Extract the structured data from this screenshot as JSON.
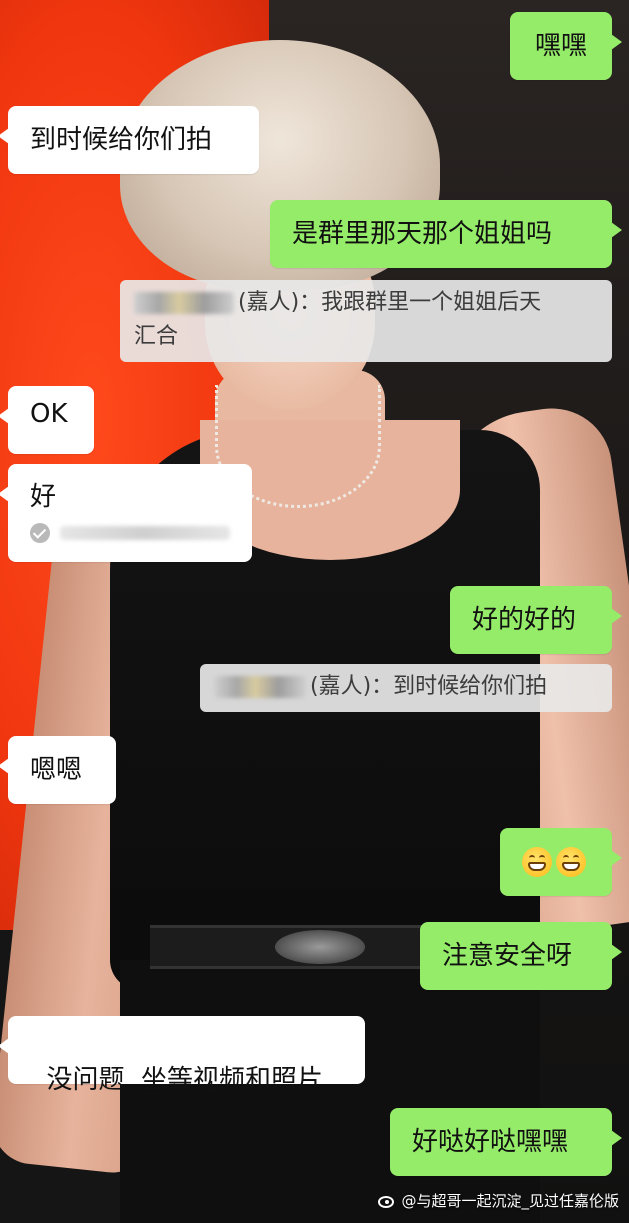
{
  "messages": {
    "m1": "嘿嘿",
    "m2": "到时候给你们拍",
    "m3": "是群里那天那个姐姐吗",
    "m3_quote_role": "(嘉人)",
    "m3_quote_text_1": "：我跟群里一个姐姐后天",
    "m3_quote_text_2": "汇合",
    "m4": "OK",
    "m5": "好",
    "m6": "好的好的",
    "m6_quote_role": "(嘉人)",
    "m6_quote_text": "：到时候给你们拍",
    "m7": "嗯嗯",
    "m8_emoji": "grinning-squinting-face-icon x2",
    "m9": "注意安全呀",
    "m10": "没问题  坐等视频和照片",
    "m11": "好哒好哒嘿嘿"
  },
  "watermark": {
    "text": "@与超哥一起沉淀_见过任嘉伦版",
    "icon": "weibo-icon"
  },
  "colors": {
    "sent_bubble": "#95ec69",
    "received_bubble": "#ffffff",
    "quote_bg": "#e8e8e8",
    "wallpaper_red": "#f0360f"
  }
}
